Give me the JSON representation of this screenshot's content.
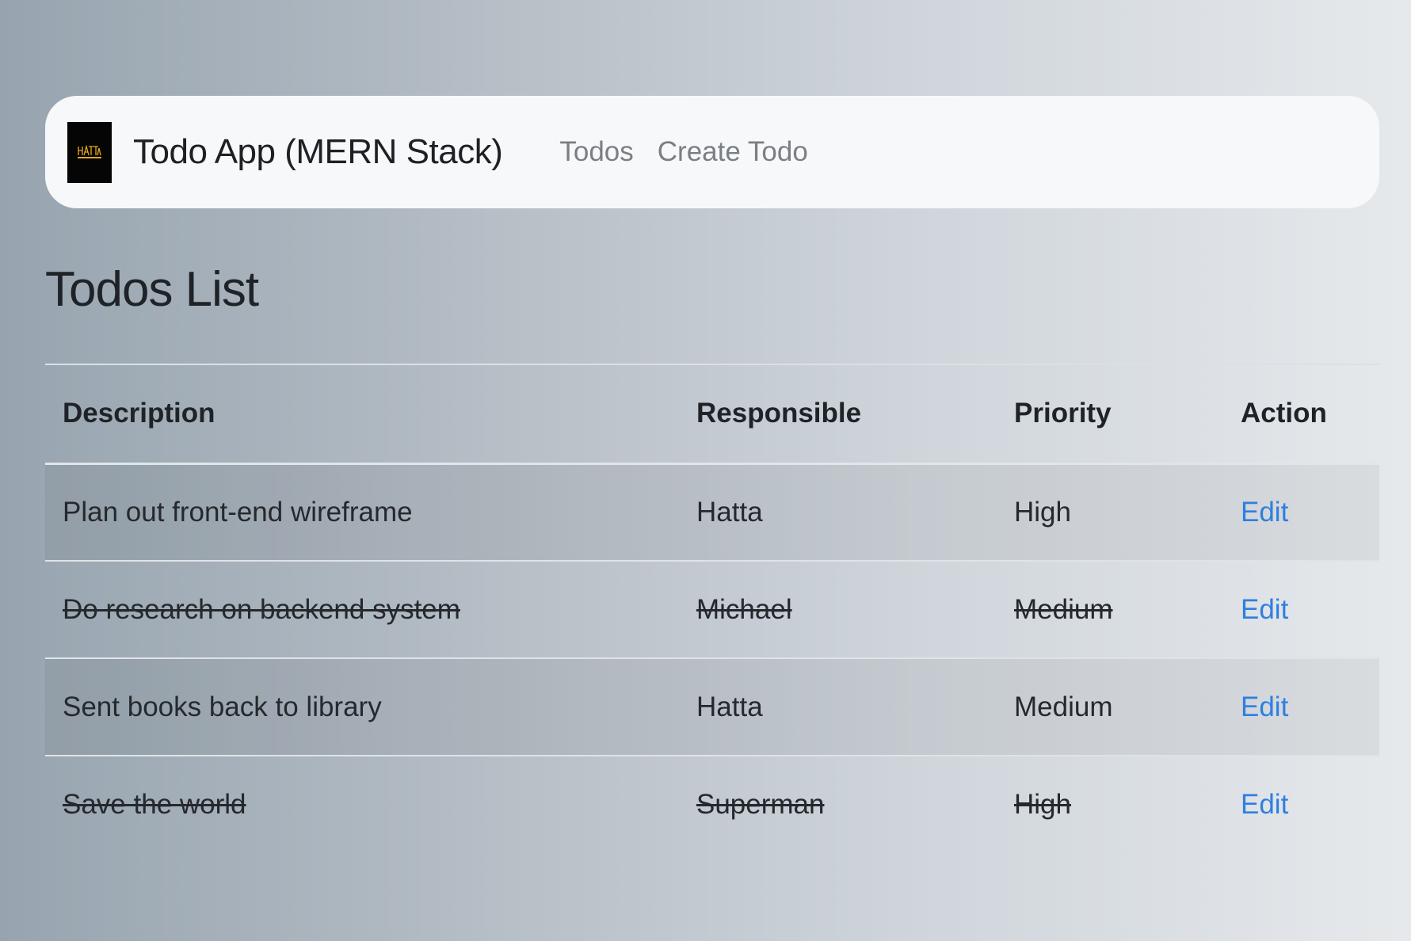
{
  "app": {
    "brand": "Todo App (MERN Stack)",
    "logo_text": "HATTA",
    "accent_color": "#e6a91c"
  },
  "nav": {
    "links": [
      {
        "label": "Todos"
      },
      {
        "label": "Create Todo"
      }
    ]
  },
  "page": {
    "title": "Todos List"
  },
  "table": {
    "columns": {
      "description": "Description",
      "responsible": "Responsible",
      "priority": "Priority",
      "action": "Action"
    },
    "rows": [
      {
        "description": "Plan out front-end wireframe",
        "responsible": "Hatta",
        "priority": "High",
        "action": "Edit",
        "completed": false
      },
      {
        "description": "Do research on backend system",
        "responsible": "Michael",
        "priority": "Medium",
        "action": "Edit",
        "completed": true
      },
      {
        "description": "Sent books back to library",
        "responsible": "Hatta",
        "priority": "Medium",
        "action": "Edit",
        "completed": false
      },
      {
        "description": "Save the world",
        "responsible": "Superman",
        "priority": "High",
        "action": "Edit",
        "completed": true
      }
    ]
  },
  "colors": {
    "link": "#2f7fe0",
    "navbar_bg": "#f7f8fa",
    "logo_bg": "#050505"
  }
}
